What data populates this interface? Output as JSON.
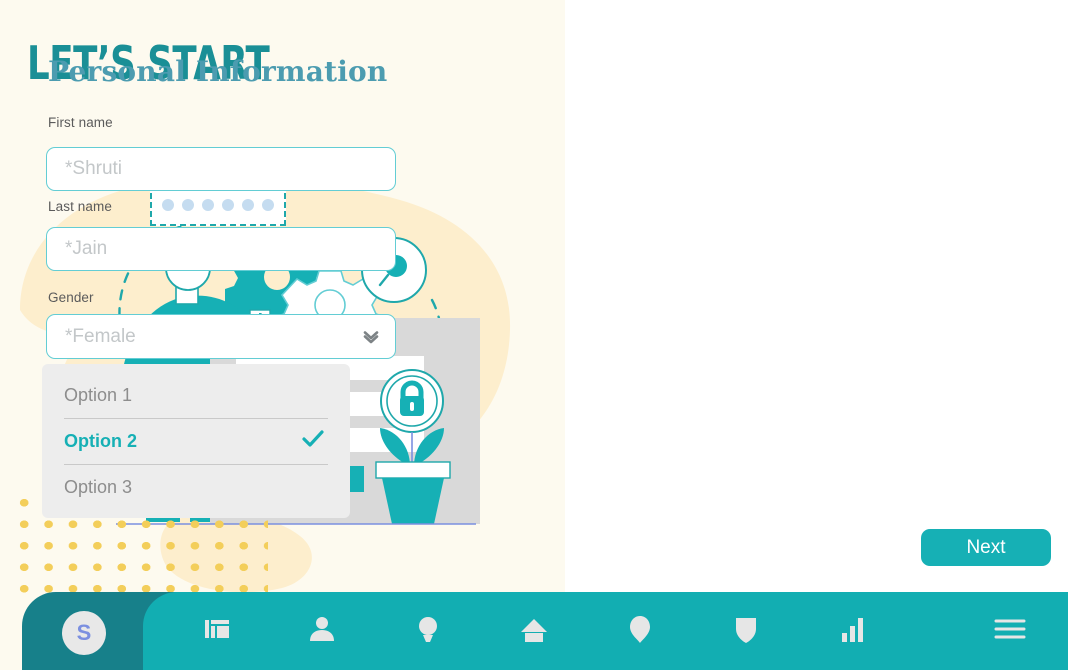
{
  "left": {
    "title": "LET’S START",
    "illustration": {
      "name": "onboarding-security-illustration",
      "password_dots_count": 6,
      "elements": [
        "person",
        "gears",
        "magnifier",
        "lock-badge",
        "form-card",
        "potted-plant",
        "dashed-arc",
        "dot-grid"
      ]
    }
  },
  "form": {
    "heading": "Personal Information",
    "fields": [
      {
        "label": "First name",
        "placeholder": "*Shruti",
        "value": ""
      },
      {
        "label": "Last name",
        "placeholder": "*Jain",
        "value": ""
      }
    ],
    "gender": {
      "label": "Gender",
      "placeholder": "*Female",
      "value": "",
      "chevron_icon": "chevron-down-icon",
      "options": [
        {
          "label": "Option 1",
          "selected": false
        },
        {
          "label": "Option 2",
          "selected": true
        },
        {
          "label": "Option 3",
          "selected": false
        }
      ]
    },
    "next_label": "Next"
  },
  "bottom_bar": {
    "avatar_initial": "S",
    "items": [
      {
        "icon": "dashboard-grid-icon"
      },
      {
        "icon": "person-icon"
      },
      {
        "icon": "lightbulb-icon"
      },
      {
        "icon": "home-icon"
      },
      {
        "icon": "location-pin-icon"
      },
      {
        "icon": "shield-icon"
      },
      {
        "icon": "bar-chart-icon"
      },
      {
        "icon": "hamburger-menu-icon"
      }
    ]
  },
  "colors": {
    "teal": "#16b0b5",
    "dark_teal": "#17808a",
    "bar_teal": "#12aeb2",
    "heading_teal": "#4c9cb0",
    "title_teal": "#1a8f96",
    "cream": "#fdfaef",
    "peach": "#fdeecd",
    "dot_yellow": "#f3ce5a",
    "panel_grey": "#ededed",
    "blue_blob": "#cde0f2"
  }
}
